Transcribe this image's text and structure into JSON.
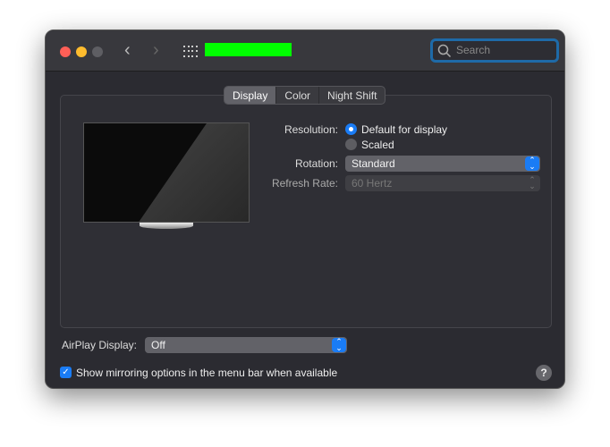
{
  "titlebar": {
    "search_placeholder": "Search",
    "title_redaction_color": "#00ff00"
  },
  "tabs": [
    {
      "label": "Display",
      "selected": true
    },
    {
      "label": "Color",
      "selected": false
    },
    {
      "label": "Night Shift",
      "selected": false
    }
  ],
  "resolution": {
    "label": "Resolution:",
    "options": [
      {
        "label": "Default for display",
        "selected": true
      },
      {
        "label": "Scaled",
        "selected": false
      }
    ]
  },
  "rotation": {
    "label": "Rotation:",
    "value": "Standard"
  },
  "refresh": {
    "label": "Refresh Rate:",
    "value": "60 Hertz",
    "disabled": true
  },
  "airplay": {
    "label": "AirPlay Display:",
    "value": "Off"
  },
  "mirroring": {
    "label": "Show mirroring options in the menu bar when available",
    "checked": true
  },
  "help": {
    "label": "?"
  },
  "colors": {
    "accent": "#1a7cf5",
    "close": "#ff5f57",
    "minimize": "#febc2e"
  }
}
